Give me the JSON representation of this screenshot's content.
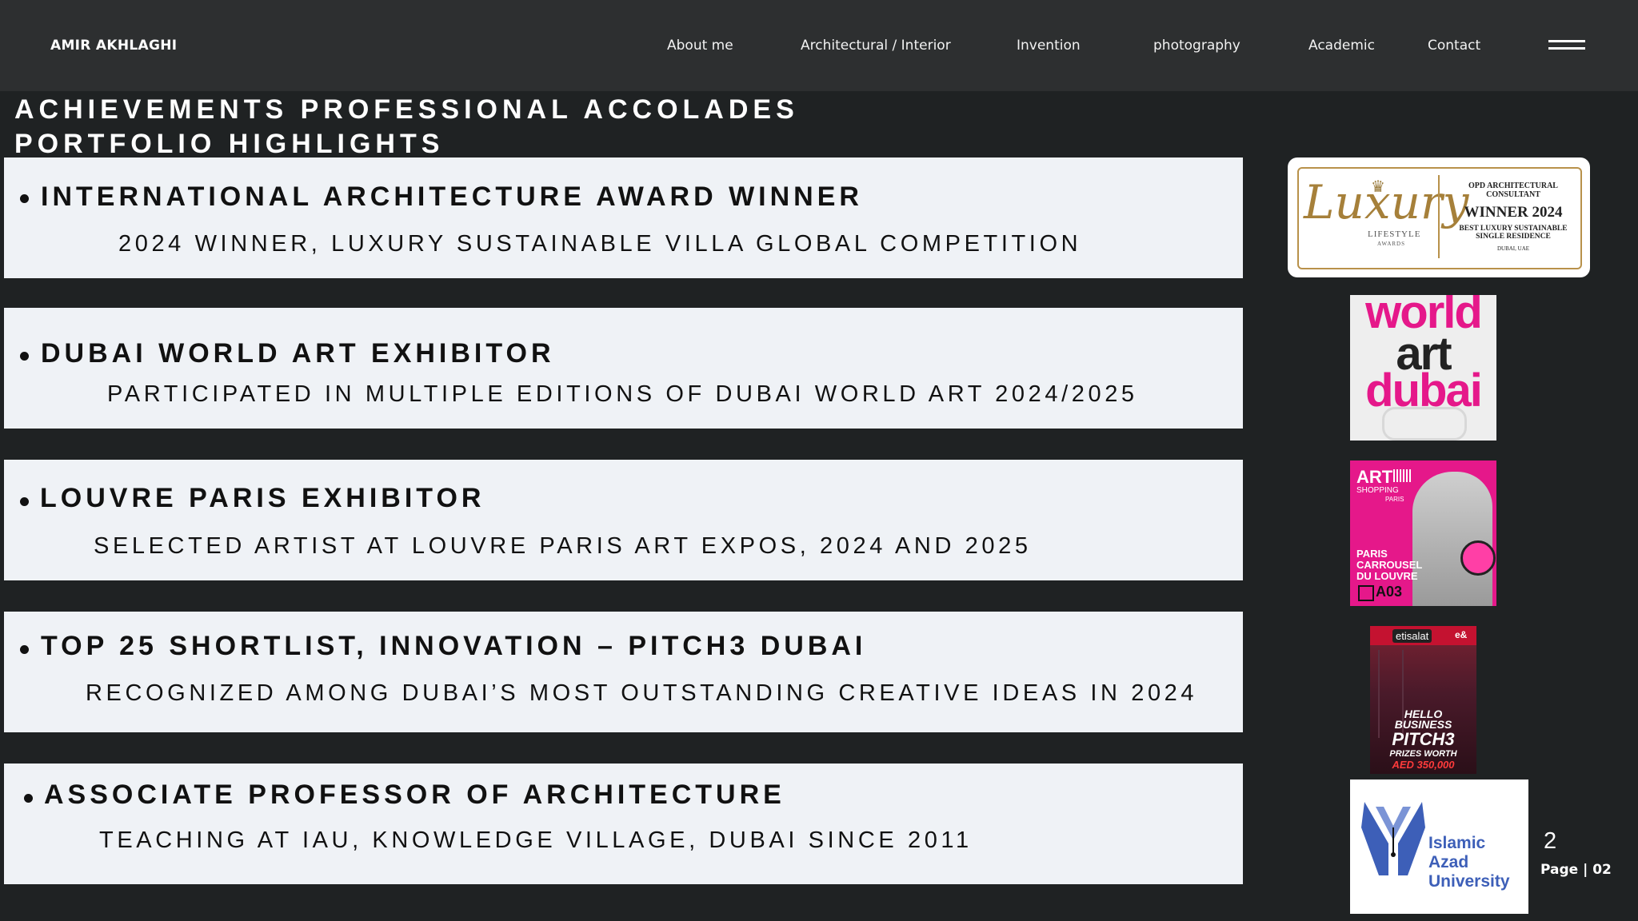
{
  "header": {
    "brand": "AMIR AKHLAGHI",
    "nav": [
      "About me",
      "Architectural / Interior",
      "Invention",
      "photography",
      "Academic",
      "Contact"
    ],
    "menu_icon": "hamburger-menu-icon"
  },
  "page": {
    "heading_line1": "ACHIEVEMENTS PROFESSIONAL ACCOLADES",
    "heading_line2": "PORTFOLIO HIGHLIGHTS"
  },
  "achievements": [
    {
      "title": "INTERNATIONAL ARCHITECTURE AWARD WINNER",
      "subtitle": "2024 WINNER, LUXURY SUSTAINABLE VILLA GLOBAL COMPETITION"
    },
    {
      "title": "DUBAI WORLD ART EXHIBITOR",
      "subtitle": "PARTICIPATED IN MULTIPLE EDITIONS OF DUBAI WORLD ART 2024/2025"
    },
    {
      "title": "LOUVRE PARIS EXHIBITOR",
      "subtitle": "SELECTED ARTIST AT LOUVRE PARIS ART EXPOS, 2024 AND 2025"
    },
    {
      "title": "TOP 25 SHORTLIST, INNOVATION – PITCH3 DUBAI",
      "subtitle": "RECOGNIZED AMONG DUBAI’S MOST OUTSTANDING CREATIVE IDEAS IN 2024"
    },
    {
      "title": "ASSOCIATE PROFESSOR OF ARCHITECTURE",
      "subtitle": "TEACHING AT IAU, KNOWLEDGE VILLAGE, DUBAI SINCE 2011"
    }
  ],
  "logos": {
    "luxury": {
      "script": "Luxury",
      "sub1": "LIFESTYLE",
      "sub2": "AWARDS",
      "line1": "OPD ARCHITECTURAL",
      "line2": "CONSULTANT",
      "winner": "WINNER 2024",
      "line3": "BEST LUXURY SUSTAINABLE",
      "line4": "SINGLE RESIDENCE",
      "line5": "DUBAI, UAE"
    },
    "worldart": {
      "w1": "world",
      "w2": "art",
      "w3": "dubai"
    },
    "artshopping": {
      "art": "ART",
      "shopping": "SHOPPING",
      "paris_small": "PARIS",
      "l1": "PARIS",
      "l2": "CARROUSEL",
      "l3": "DU LOUVRE",
      "booth": "A03"
    },
    "pitch": {
      "brand": "etisalat",
      "brand2": "e&",
      "l1": "HELLO",
      "l2": "BUSINESS",
      "l3": "PITCH",
      "l3b": "3",
      "l4": "PRIZES WORTH",
      "l5": "AED 350,000"
    },
    "iau": {
      "l1": "Islamic",
      "l2": "Azad",
      "l3": "University"
    }
  },
  "footer": {
    "page_number": "2",
    "page_label": "Page | 02"
  },
  "colors": {
    "background": "#1f2223",
    "topbar": "#2d2f30",
    "card": "#eff2f6",
    "accent_pink": "#e5188a",
    "gold": "#b8914a",
    "iau_blue": "#3d5fb8"
  }
}
